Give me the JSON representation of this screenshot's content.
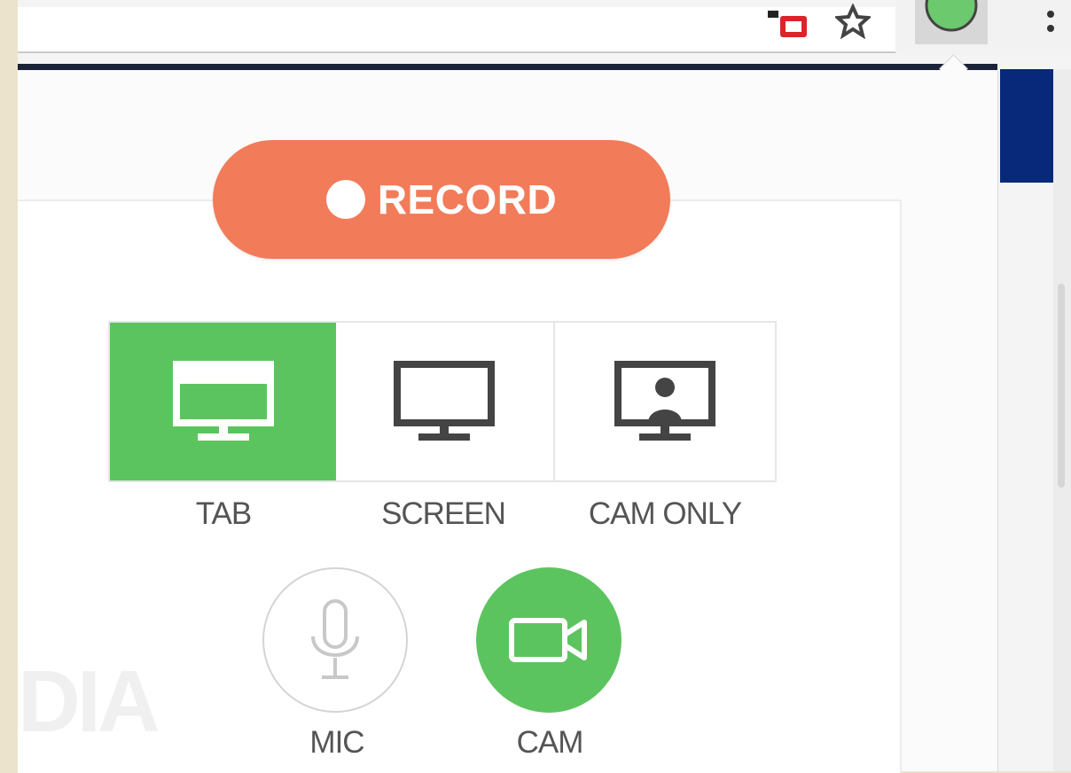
{
  "popup": {
    "record_label": "RECORD",
    "modes": [
      {
        "label": "TAB",
        "icon": "tab-monitor-icon",
        "selected": true
      },
      {
        "label": "SCREEN",
        "icon": "monitor-icon",
        "selected": false
      },
      {
        "label": "CAM ONLY",
        "icon": "monitor-person-icon",
        "selected": false
      }
    ],
    "toggles": [
      {
        "label": "MIC",
        "icon": "microphone-icon",
        "on": false
      },
      {
        "label": "CAM",
        "icon": "video-camera-icon",
        "on": true
      }
    ],
    "watermark_text": "DIA"
  },
  "colors": {
    "accent_record": "#f27b5a",
    "accent_active": "#5cc45e",
    "navy": "#08287a"
  }
}
